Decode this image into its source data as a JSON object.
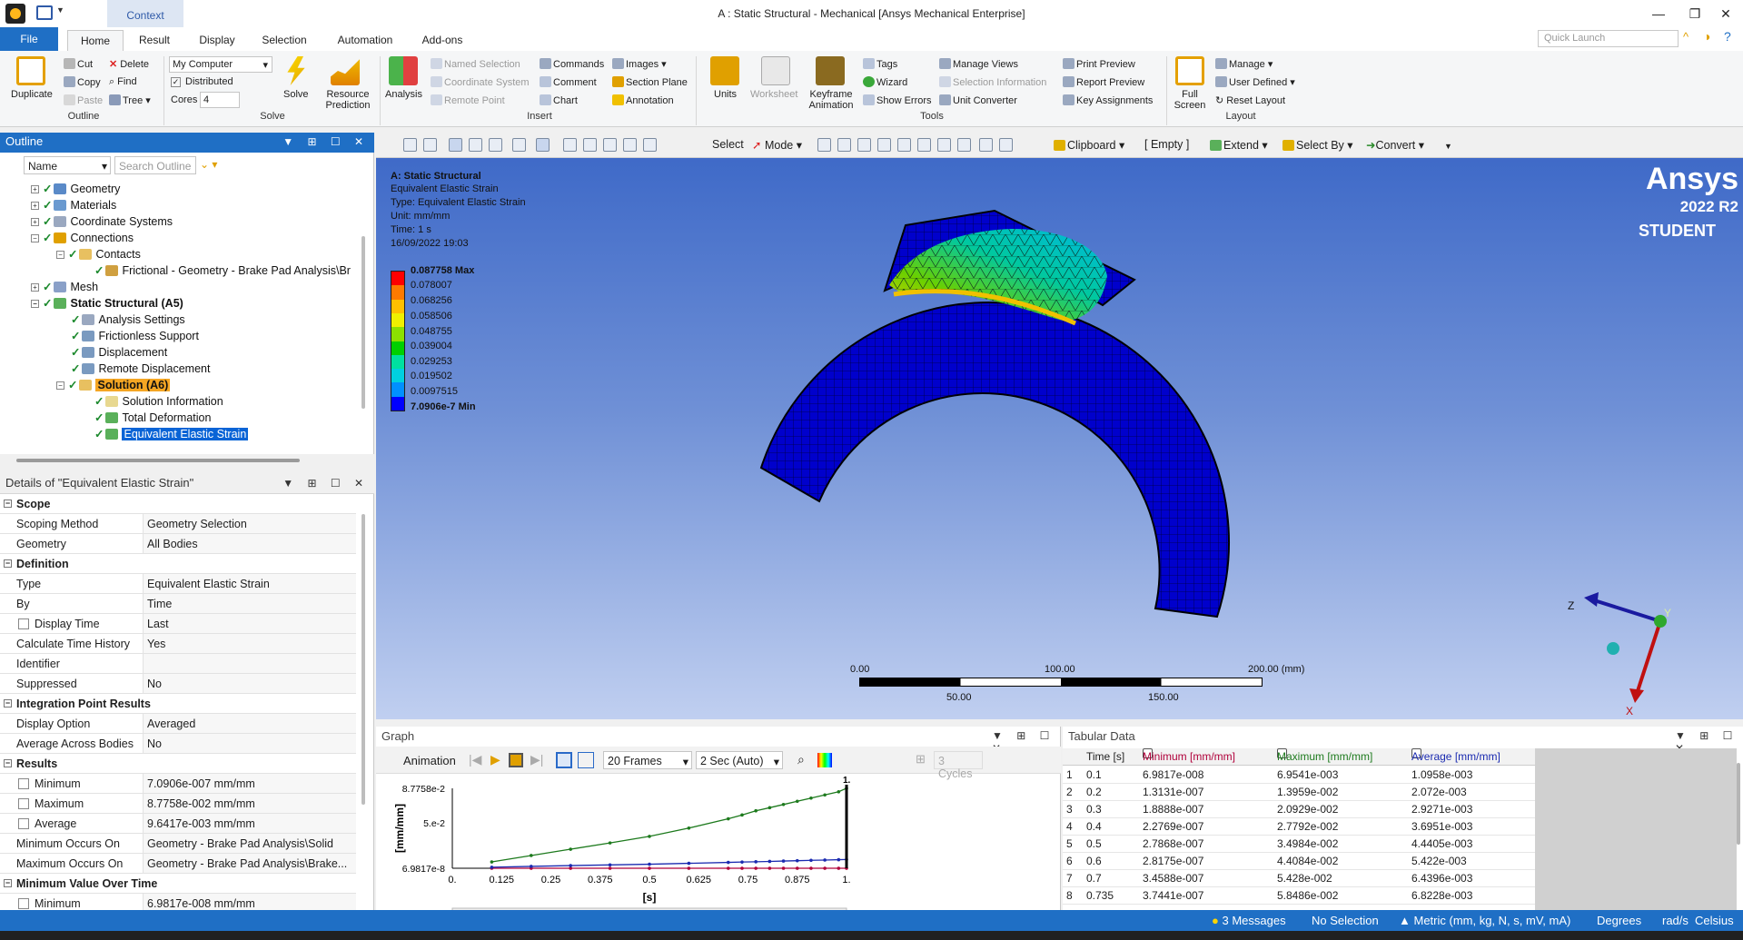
{
  "window": {
    "title": "A : Static Structural - Mechanical [Ansys Mechanical Enterprise]",
    "context_tab": "Context"
  },
  "tabs": [
    "File",
    "Home",
    "Result",
    "Display",
    "Selection",
    "Automation",
    "Add-ons"
  ],
  "quick_launch_placeholder": "Quick Launch",
  "ribbon": {
    "outline": {
      "duplicate": "Duplicate",
      "cut": "Cut",
      "copy": "Copy",
      "paste": "Paste",
      "delete": "Delete",
      "find": "Find",
      "tree": "Tree",
      "group": "Outline"
    },
    "solve": {
      "computer": "My Computer",
      "distributed": "Distributed",
      "cores_label": "Cores",
      "cores_value": "4",
      "solve": "Solve",
      "resource_prediction": "Resource Prediction",
      "group": "Solve"
    },
    "insert": {
      "analysis": "Analysis",
      "named_selection": "Named Selection",
      "coordinate_system": "Coordinate System",
      "remote_point": "Remote Point",
      "commands": "Commands",
      "comment": "Comment",
      "chart": "Chart",
      "images": "Images",
      "section_plane": "Section Plane",
      "annotation": "Annotation",
      "group": "Insert"
    },
    "tools": {
      "units": "Units",
      "worksheet": "Worksheet",
      "keyframe_animation": "Keyframe Animation",
      "tags": "Tags",
      "wizard": "Wizard",
      "show_errors": "Show Errors",
      "manage_views": "Manage Views",
      "selection_information": "Selection Information",
      "unit_converter": "Unit Converter",
      "print_preview": "Print Preview",
      "report_preview": "Report Preview",
      "key_assignments": "Key Assignments",
      "group": "Tools"
    },
    "layout": {
      "full_screen": "Full Screen",
      "manage": "Manage",
      "user_defined": "User Defined",
      "reset_layout": "Reset Layout",
      "group": "Layout"
    }
  },
  "outline": {
    "title": "Outline",
    "name_filter": "Name",
    "search_placeholder": "Search Outline",
    "items": [
      {
        "label": "Geometry"
      },
      {
        "label": "Materials"
      },
      {
        "label": "Coordinate Systems"
      },
      {
        "label": "Connections"
      },
      {
        "label": "Contacts"
      },
      {
        "label": "Frictional - Geometry - Brake Pad Analysis\\Br"
      },
      {
        "label": "Mesh"
      },
      {
        "label": "Static Structural (A5)"
      },
      {
        "label": "Analysis Settings"
      },
      {
        "label": "Frictionless Support"
      },
      {
        "label": "Displacement"
      },
      {
        "label": "Remote Displacement"
      },
      {
        "label": "Solution (A6)"
      },
      {
        "label": "Solution Information"
      },
      {
        "label": "Total Deformation"
      },
      {
        "label": "Equivalent Elastic Strain"
      }
    ]
  },
  "details": {
    "title": "Details of \"Equivalent Elastic Strain\"",
    "rows": [
      {
        "k": "Scope",
        "v": ""
      },
      {
        "k": "Scoping Method",
        "v": "Geometry Selection"
      },
      {
        "k": "Geometry",
        "v": "All Bodies"
      },
      {
        "k": "Definition",
        "v": ""
      },
      {
        "k": "Type",
        "v": "Equivalent Elastic Strain"
      },
      {
        "k": "By",
        "v": "Time"
      },
      {
        "k": "Display Time",
        "v": "Last"
      },
      {
        "k": "Calculate Time History",
        "v": "Yes"
      },
      {
        "k": "Identifier",
        "v": ""
      },
      {
        "k": "Suppressed",
        "v": "No"
      },
      {
        "k": "Integration Point Results",
        "v": ""
      },
      {
        "k": "Display Option",
        "v": "Averaged"
      },
      {
        "k": "Average Across Bodies",
        "v": "No"
      },
      {
        "k": "Results",
        "v": ""
      },
      {
        "k": "Minimum",
        "v": "7.0906e-007 mm/mm"
      },
      {
        "k": "Maximum",
        "v": "8.7758e-002 mm/mm"
      },
      {
        "k": "Average",
        "v": "9.6417e-003 mm/mm"
      },
      {
        "k": "Minimum Occurs On",
        "v": "Geometry - Brake Pad Analysis\\Solid"
      },
      {
        "k": "Maximum Occurs On",
        "v": "Geometry - Brake Pad Analysis\\Brake..."
      },
      {
        "k": "Minimum Value Over Time",
        "v": ""
      },
      {
        "k": "Minimum",
        "v": "6.9817e-008 mm/mm"
      }
    ]
  },
  "viewport": {
    "toolbar": {
      "select": "Select",
      "mode": "Mode",
      "clipboard": "Clipboard",
      "empty": "[ Empty ]",
      "extend": "Extend",
      "select_by": "Select By",
      "convert": "Convert"
    },
    "info": [
      "A: Static Structural",
      "Equivalent Elastic Strain",
      "Type: Equivalent Elastic Strain",
      "Unit: mm/mm",
      "Time: 1 s",
      "16/09/2022 19:03"
    ],
    "legend": {
      "max": "0.087758 Max",
      "values": [
        "0.078007",
        "0.068256",
        "0.058506",
        "0.048755",
        "0.039004",
        "0.029253",
        "0.019502",
        "0.0097515"
      ],
      "min": "7.0906e-7 Min",
      "colors": [
        "#ff0000",
        "#ff7a00",
        "#ffc000",
        "#f0f000",
        "#8ce000",
        "#00d000",
        "#00e0a0",
        "#00d0e0",
        "#0090ff",
        "#0000ff"
      ]
    },
    "brand": {
      "name": "Ansys",
      "version": "2022 R2",
      "edition": "STUDENT"
    },
    "scale": {
      "top": [
        "0.00",
        "100.00",
        "200.00 (mm)"
      ],
      "bottom": [
        "50.00",
        "150.00"
      ]
    },
    "triad": {
      "z": "Z",
      "y": "Y",
      "x": "X"
    }
  },
  "graph": {
    "title": "Graph",
    "animation": "Animation",
    "frames": "20 Frames",
    "speed": "2 Sec (Auto)",
    "cycles": "3 Cycles",
    "ylabel": "[mm/mm]",
    "xlabel": "[s]",
    "marker": "1.",
    "scroll_label": "1"
  },
  "chart_data": {
    "type": "line",
    "xlabel": "[s]",
    "ylabel": "[mm/mm]",
    "x_ticks": [
      "0.",
      "0.125",
      "0.25",
      "0.375",
      "0.5",
      "0.625",
      "0.75",
      "0.875",
      "1."
    ],
    "y_ticks": [
      "8.7758e-2",
      "5.e-2",
      "6.9817e-8"
    ],
    "x": [
      0.1,
      0.2,
      0.3,
      0.4,
      0.5,
      0.6,
      0.7,
      0.735,
      0.77,
      0.805,
      0.84,
      0.875,
      0.91,
      0.945,
      0.98,
      1.0
    ],
    "ylim": [
      6.9817e-08,
      0.087758
    ],
    "series": [
      {
        "name": "Minimum [mm/mm]",
        "color": "#b0003a",
        "values": [
          6.98e-08,
          1.31e-07,
          1.89e-07,
          2.28e-07,
          2.79e-07,
          2.82e-07,
          3.46e-07,
          3.74e-07,
          4.21e-07,
          4.5e-07,
          4.8e-07,
          5.1e-07,
          5.5e-07,
          6e-07,
          6.5e-07,
          7.09e-07
        ]
      },
      {
        "name": "Maximum [mm/mm]",
        "color": "#1d7a1d",
        "values": [
          0.00695,
          0.014,
          0.0209,
          0.0278,
          0.035,
          0.0441,
          0.0543,
          0.0585,
          0.0631,
          0.0665,
          0.07,
          0.0735,
          0.077,
          0.0805,
          0.084,
          0.0878
        ]
      },
      {
        "name": "Average [mm/mm]",
        "color": "#1a2ab0",
        "values": [
          0.0011,
          0.00207,
          0.00293,
          0.0037,
          0.00444,
          0.00542,
          0.00644,
          0.00682,
          0.00712,
          0.0075,
          0.0079,
          0.0083,
          0.0087,
          0.009,
          0.0094,
          0.0096
        ]
      }
    ]
  },
  "tabular": {
    "title": "Tabular Data",
    "headers": [
      "Time [s]",
      "Minimum [mm/mm]",
      "Maximum [mm/mm]",
      "Average [mm/mm]"
    ],
    "header_colors": [
      "#1e1e1e",
      "#b0003a",
      "#1d7a1d",
      "#1a2ab0"
    ],
    "rows": [
      [
        "1",
        "0.1",
        "6.9817e-008",
        "6.9541e-003",
        "1.0958e-003"
      ],
      [
        "2",
        "0.2",
        "1.3131e-007",
        "1.3959e-002",
        "2.072e-003"
      ],
      [
        "3",
        "0.3",
        "1.8888e-007",
        "2.0929e-002",
        "2.9271e-003"
      ],
      [
        "4",
        "0.4",
        "2.2769e-007",
        "2.7792e-002",
        "3.6951e-003"
      ],
      [
        "5",
        "0.5",
        "2.7868e-007",
        "3.4984e-002",
        "4.4405e-003"
      ],
      [
        "6",
        "0.6",
        "2.8175e-007",
        "4.4084e-002",
        "5.422e-003"
      ],
      [
        "7",
        "0.7",
        "3.4588e-007",
        "5.428e-002",
        "6.4396e-003"
      ],
      [
        "8",
        "0.735",
        "3.7441e-007",
        "5.8486e-002",
        "6.8228e-003"
      ]
    ]
  },
  "statusbar": {
    "messages": "3 Messages",
    "selection": "No Selection",
    "units": "Metric (mm, kg, N, s, mV, mA)",
    "angle": "Degrees",
    "rate": "rad/s",
    "temp": "Celsius"
  }
}
